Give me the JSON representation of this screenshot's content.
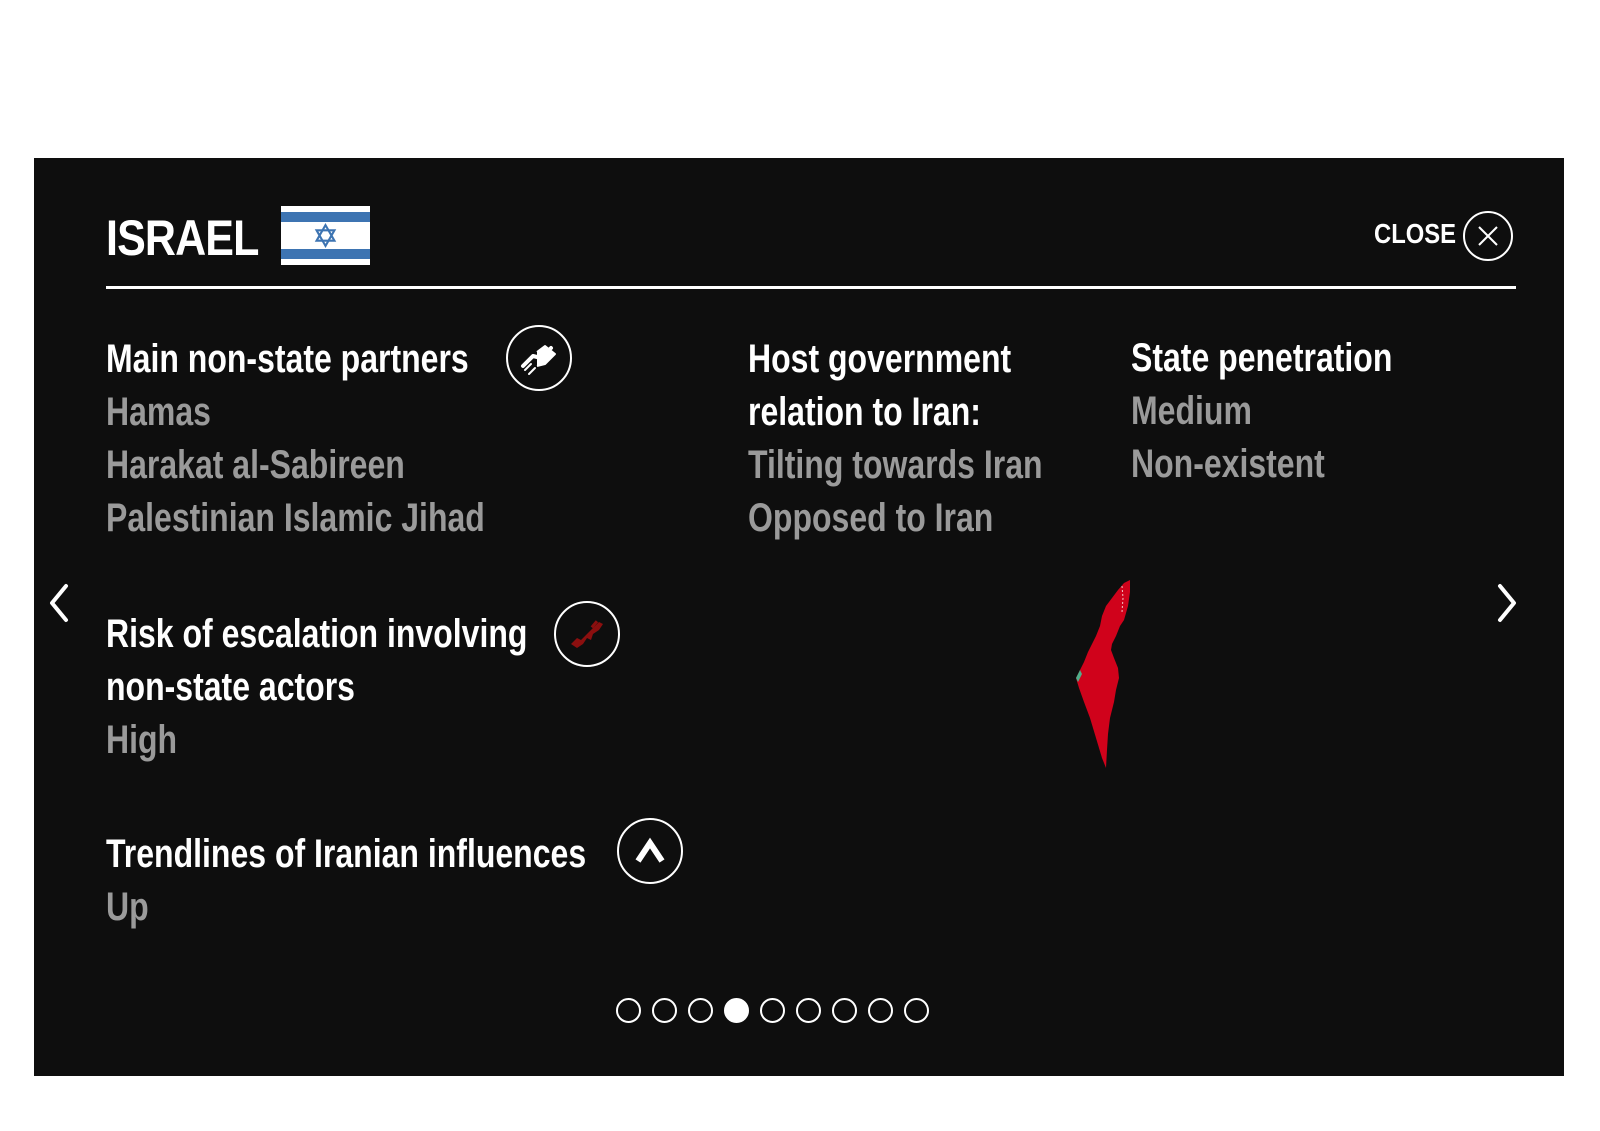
{
  "header": {
    "country": "ISRAEL",
    "close_label": "CLOSE"
  },
  "sections": {
    "partners": {
      "title": "Main non-state partners",
      "items": [
        "Hamas",
        "Harakat al-Sabireen",
        "Palestinian Islamic Jihad"
      ]
    },
    "host_gov": {
      "title_line1": "Host government",
      "title_line2": "relation to Iran:",
      "items": [
        "Tilting towards Iran",
        "Opposed to Iran"
      ]
    },
    "state_penetration": {
      "title": "State penetration",
      "items": [
        "Medium",
        "Non-existent"
      ]
    },
    "risk": {
      "title_line1": "Risk of escalation involving",
      "title_line2": "non-state actors",
      "value": "High"
    },
    "trendlines": {
      "title": "Trendlines of Iranian influences",
      "value": "Up"
    }
  },
  "pager": {
    "total": 9,
    "active_index": 3
  },
  "colors": {
    "background": "#0e0e0e",
    "heading": "#ffffff",
    "value": "#9a9a9a",
    "map_fill": "#d0021b",
    "flag_blue": "#3d74b2",
    "risk_icon": "#8b0f0f"
  },
  "icons": {
    "partners": "handshake-icon",
    "risk": "rifle-icon",
    "trend": "arrow-up-icon",
    "close": "close-icon",
    "prev": "chevron-left-icon",
    "next": "chevron-right-icon"
  }
}
